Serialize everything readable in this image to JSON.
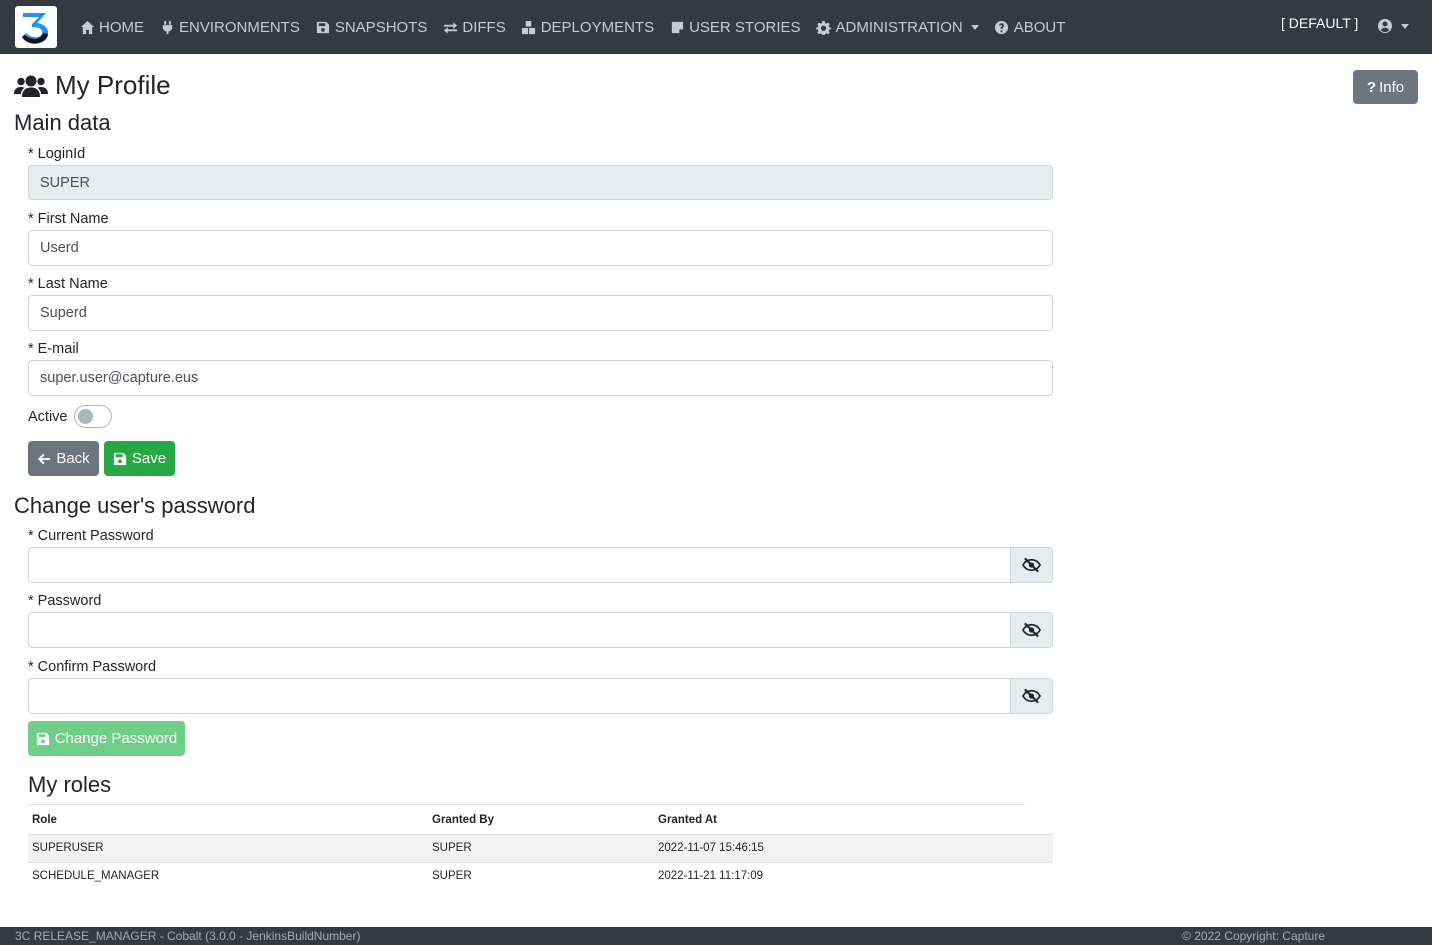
{
  "nav": {
    "items": [
      {
        "label": "HOME",
        "icon": "home-icon"
      },
      {
        "label": "ENVIRONMENTS",
        "icon": "plug-icon"
      },
      {
        "label": "SNAPSHOTS",
        "icon": "save-icon"
      },
      {
        "label": "DIFFS",
        "icon": "exchange-icon"
      },
      {
        "label": "DEPLOYMENTS",
        "icon": "boxes-icon"
      },
      {
        "label": "USER STORIES",
        "icon": "sticky-note-icon"
      },
      {
        "label": "ADMINISTRATION",
        "icon": "cog-icon"
      },
      {
        "label": "ABOUT",
        "icon": "question-circle-icon"
      }
    ],
    "environment": "[ DEFAULT ]"
  },
  "page": {
    "title": "My Profile",
    "info_label": "Info"
  },
  "main_data": {
    "heading": "Main data",
    "login_label": "* LoginId",
    "login_value": "SUPER",
    "first_name_label": "* First Name",
    "first_name_value": "Userd",
    "last_name_label": "* Last Name",
    "last_name_value": "Superd",
    "email_label": "* E-mail",
    "email_value": "super.user@capture.eus",
    "active_label": "Active",
    "active": false,
    "back_label": "Back",
    "save_label": "Save"
  },
  "password": {
    "heading": "Change user's password",
    "current_label": "* Current Password",
    "password_label": "* Password",
    "confirm_label": "* Confirm Password",
    "change_label": "Change Password"
  },
  "roles": {
    "heading": "My roles",
    "columns": [
      "Role",
      "Granted By",
      "Granted At"
    ],
    "rows": [
      [
        "SUPERUSER",
        "SUPER",
        "2022-11-07 15:46:15"
      ],
      [
        "SCHEDULE_MANAGER",
        "SUPER",
        "2022-11-21 11:17:09"
      ]
    ]
  },
  "footer": {
    "left": "3C RELEASE_MANAGER - Cobalt (3.0.0 - JenkinsBuildNumber)",
    "right": "© 2022 Copyright: Capture"
  },
  "colors": {
    "navbar": "#343a40",
    "primary_gray": "#6c757d",
    "success": "#28a745",
    "success_disabled": "#6fcf86"
  }
}
